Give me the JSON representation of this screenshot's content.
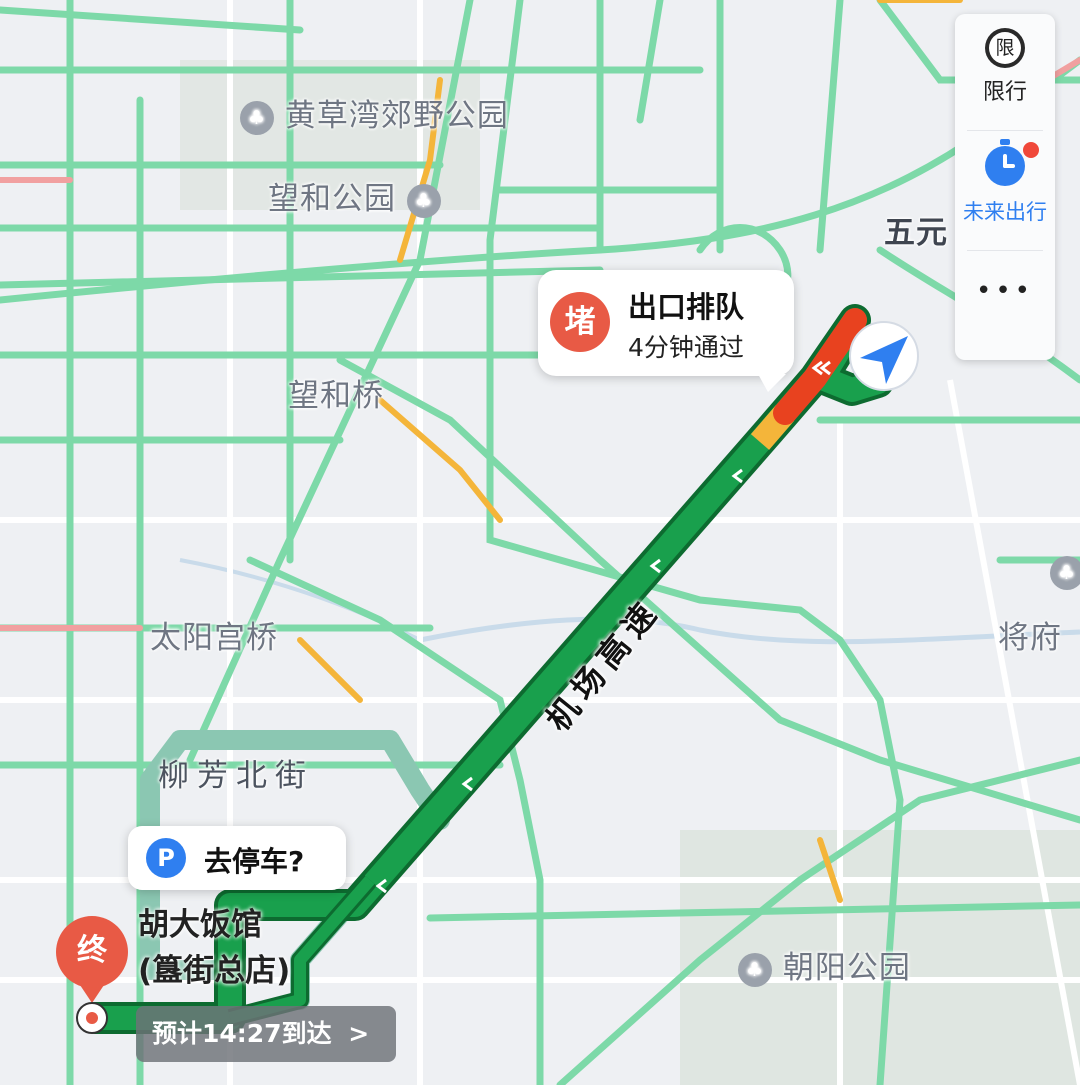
{
  "map_labels": {
    "huangcaowan_park": "黄草湾郊野公园",
    "wanghe_park": "望和公园",
    "wuyuan": "五元",
    "wanghe_bridge": "望和桥",
    "taiyanggong_bridge": "太阳宫桥",
    "liufang_north_st": "柳芳北街",
    "jiangfu": "将府",
    "chaoyang_park": "朝阳公园",
    "airport_expressway": "机场高速"
  },
  "side_panel": {
    "restriction_icon_text": "限",
    "restriction_label": "限行",
    "future_travel_label": "未来出行",
    "more_label": "•••"
  },
  "congestion_callout": {
    "badge": "堵",
    "title": "出口排队",
    "subtitle": "4分钟通过"
  },
  "parking_callout": {
    "icon": "P",
    "label": "去停车?"
  },
  "destination": {
    "badge": "终",
    "name_line1": "胡大饭馆",
    "name_line2": "(簋街总店)"
  },
  "eta": {
    "text": "预计14:27到达",
    "chevron": ">"
  },
  "colors": {
    "route_green": "#19a04d",
    "route_border": "#0d6b30",
    "congestion_red": "#e8421f",
    "slow_yellow": "#f4b53a",
    "road_green": "#7dd9a8",
    "accent_blue": "#2f7ff0",
    "badge_red": "#e85a45"
  }
}
